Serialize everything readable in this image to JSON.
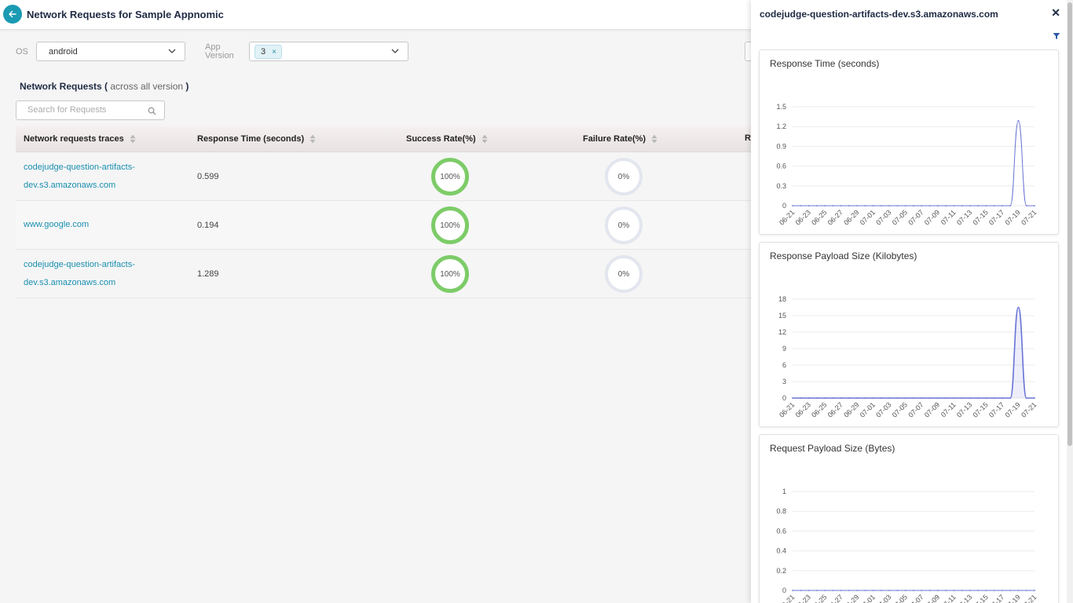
{
  "header": {
    "title": "Network Requests for Sample Appnomic"
  },
  "filters": {
    "os_label": "OS",
    "os_value": "android",
    "app_version_label_1": "App",
    "app_version_label_2": "Version",
    "app_version_tag": "3"
  },
  "section": {
    "title": "Network Requests (",
    "subtitle": " across all version ",
    "close_paren": ")"
  },
  "search": {
    "placeholder": "Search for Requests"
  },
  "table": {
    "columns": [
      "Network requests traces",
      "Response Time (seconds)",
      "Success Rate(%)",
      "Failure Rate(%)",
      "R"
    ],
    "rows": [
      {
        "trace_line1": "codejudge-question-artifacts-",
        "trace_line2": "dev.s3.amazonaws.com",
        "response_time": "0.599",
        "success": "100%",
        "failure": "0%"
      },
      {
        "trace_line1": "www.google.com",
        "trace_line2": "",
        "response_time": "0.194",
        "success": "100%",
        "failure": "0%"
      },
      {
        "trace_line1": "codejudge-question-artifacts-",
        "trace_line2": "dev.s3.amazonaws.com",
        "response_time": "1.289",
        "success": "100%",
        "failure": "0%"
      }
    ]
  },
  "panel": {
    "title": "codejudge-question-artifacts-dev.s3.amazonaws.com"
  },
  "colors": {
    "accent": "#1a9bb3",
    "success": "#7dcc68",
    "line": "#6a74d6"
  },
  "chart_data": [
    {
      "type": "line",
      "title": "Response Time (seconds)",
      "x": [
        "06-21",
        "06-22",
        "06-23",
        "06-24",
        "06-25",
        "06-26",
        "06-27",
        "06-28",
        "06-29",
        "06-30",
        "07-01",
        "07-02",
        "07-03",
        "07-04",
        "07-05",
        "07-06",
        "07-07",
        "07-08",
        "07-09",
        "07-10",
        "07-11",
        "07-12",
        "07-13",
        "07-14",
        "07-15",
        "07-16",
        "07-17",
        "07-18",
        "07-19",
        "07-20",
        "07-21"
      ],
      "x_tick_labels": [
        "06-21",
        "06-23",
        "06-25",
        "06-27",
        "06-29",
        "07-01",
        "07-03",
        "07-05",
        "07-07",
        "07-09",
        "07-11",
        "07-13",
        "07-15",
        "07-17",
        "07-19",
        "07-21"
      ],
      "values": [
        0,
        0,
        0,
        0,
        0,
        0,
        0,
        0,
        0,
        0,
        0,
        0,
        0,
        0,
        0,
        0,
        0,
        0,
        0,
        0,
        0,
        0,
        0,
        0,
        0,
        0,
        0,
        0,
        1.289,
        0,
        0
      ],
      "y_ticks": [
        "0",
        "0.3",
        "0.6",
        "0.9",
        "1.2",
        "1.5"
      ],
      "ylim": [
        0,
        1.5
      ],
      "fill": false
    },
    {
      "type": "area",
      "title": "Response Payload Size (Kilobytes)",
      "x": [
        "06-21",
        "06-22",
        "06-23",
        "06-24",
        "06-25",
        "06-26",
        "06-27",
        "06-28",
        "06-29",
        "06-30",
        "07-01",
        "07-02",
        "07-03",
        "07-04",
        "07-05",
        "07-06",
        "07-07",
        "07-08",
        "07-09",
        "07-10",
        "07-11",
        "07-12",
        "07-13",
        "07-14",
        "07-15",
        "07-16",
        "07-17",
        "07-18",
        "07-19",
        "07-20",
        "07-21"
      ],
      "x_tick_labels": [
        "06-21",
        "06-23",
        "06-25",
        "06-27",
        "06-29",
        "07-01",
        "07-03",
        "07-05",
        "07-07",
        "07-09",
        "07-11",
        "07-13",
        "07-15",
        "07-17",
        "07-19",
        "07-21"
      ],
      "values": [
        0,
        0,
        0,
        0,
        0,
        0,
        0,
        0,
        0,
        0,
        0,
        0,
        0,
        0,
        0,
        0,
        0,
        0,
        0,
        0,
        0,
        0,
        0,
        0,
        0,
        0,
        0,
        0,
        16.5,
        0,
        0
      ],
      "y_ticks": [
        "0",
        "3",
        "6",
        "9",
        "12",
        "15",
        "18"
      ],
      "ylim": [
        0,
        18
      ],
      "fill": true
    },
    {
      "type": "line",
      "title": "Request Payload Size (Bytes)",
      "x": [
        "06-21",
        "06-22",
        "06-23",
        "06-24",
        "06-25",
        "06-26",
        "06-27",
        "06-28",
        "06-29",
        "06-30",
        "07-01",
        "07-02",
        "07-03",
        "07-04",
        "07-05",
        "07-06",
        "07-07",
        "07-08",
        "07-09",
        "07-10",
        "07-11",
        "07-12",
        "07-13",
        "07-14",
        "07-15",
        "07-16",
        "07-17",
        "07-18",
        "07-19",
        "07-20",
        "07-21"
      ],
      "x_tick_labels": [
        "06-21",
        "06-23",
        "06-25",
        "06-27",
        "06-29",
        "07-01",
        "07-03",
        "07-05",
        "07-07",
        "07-09",
        "07-11",
        "07-13",
        "07-15",
        "07-17",
        "07-19",
        "07-21"
      ],
      "values": [
        0,
        0,
        0,
        0,
        0,
        0,
        0,
        0,
        0,
        0,
        0,
        0,
        0,
        0,
        0,
        0,
        0,
        0,
        0,
        0,
        0,
        0,
        0,
        0,
        0,
        0,
        0,
        0,
        0,
        0,
        0
      ],
      "y_ticks": [
        "0",
        "0.2",
        "0.4",
        "0.6",
        "0.8",
        "1"
      ],
      "ylim": [
        0,
        1
      ],
      "fill": false
    }
  ]
}
